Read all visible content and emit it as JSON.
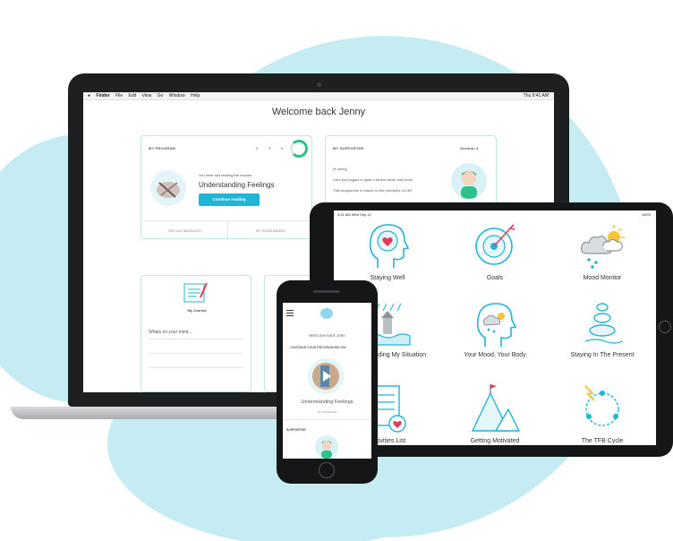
{
  "laptop": {
    "menubar": {
      "apple": "",
      "items": [
        "Finder",
        "File",
        "Edit",
        "View",
        "Go",
        "Window",
        "Help"
      ],
      "clock": "Thu 9:41 AM"
    },
    "welcome": "Welcome back Jenny",
    "program": {
      "heading": "MY PROGRAM",
      "steps": [
        "2",
        "3",
        "6"
      ],
      "progress_fraction": 0.6,
      "last_reading": "You were last reading the module...",
      "module": "Understanding Feelings",
      "continue": "Continue reading",
      "see_all": "SEE ALL MODULES",
      "bookmarks": "MY BOOKMARKS"
    },
    "supporter": {
      "heading": "MY SUPPORTER",
      "session": "Session 4",
      "greeting": "Hi Jenny,",
      "msg1": "I see you logged in quite a bit this week, well done.",
      "msg2": "This programme is based on the principles of CBT"
    },
    "journal": {
      "title": "My Journal",
      "prompt": "Whats on your mind..."
    }
  },
  "tablet": {
    "time": "9:41 AM  Wed Sep 12",
    "battery": "100%",
    "tiles": [
      {
        "label": "Staying Well",
        "icon": "head-heart-icon"
      },
      {
        "label": "Goals",
        "icon": "target-icon"
      },
      {
        "label": "Mood Monitor",
        "icon": "weather-icon"
      },
      {
        "label": "Understanding My Situation",
        "icon": "lighthouse-icon"
      },
      {
        "label": "Your Mood, Your Body",
        "icon": "head-weather-icon"
      },
      {
        "label": "Staying In The Present",
        "icon": "stones-icon"
      },
      {
        "label": "Activities List",
        "icon": "list-heart-icon"
      },
      {
        "label": "Getting Motivated",
        "icon": "mountain-flag-icon"
      },
      {
        "label": "The TFB Cycle",
        "icon": "cycle-icon"
      }
    ]
  },
  "phone": {
    "welcome": "Welcome back Jenn",
    "program_label": "CONTINUE YOUR PROGRAM BELOW",
    "module": "Understanding Feelings",
    "see_all": "ALL MODULES",
    "supporter": "SUPPORTER"
  },
  "colors": {
    "accent": "#1fb4d8",
    "blob": "#c6ecf3",
    "progress": "#2ec08a",
    "heart": "#e03a5a"
  }
}
